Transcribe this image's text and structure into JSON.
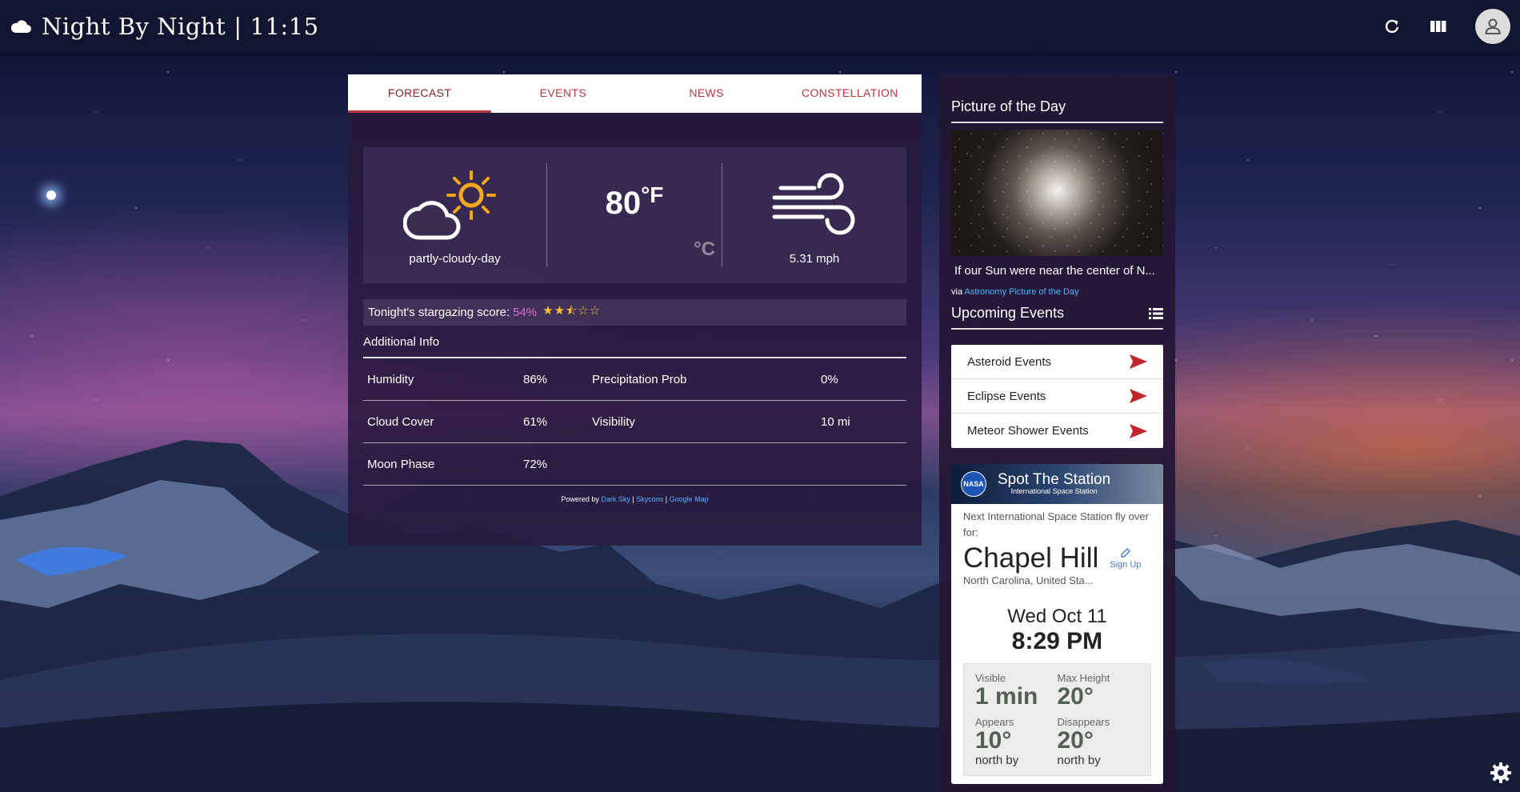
{
  "header": {
    "title": "Night By Night",
    "separator": "|",
    "time": "11:15"
  },
  "tabs": [
    {
      "label": "FORECAST",
      "active": true
    },
    {
      "label": "EVENTS",
      "active": false
    },
    {
      "label": "NEWS",
      "active": false
    },
    {
      "label": "CONSTELLATION",
      "active": false
    }
  ],
  "forecast": {
    "icon_label": "partly-cloudy-day",
    "temperature": "80",
    "unit_primary": "°F",
    "unit_alt": "°C",
    "wind": "5.31 mph",
    "stargazing_label": "Tonight's stargazing score:",
    "stargazing_score": "54%",
    "stars_text": "★★⯪☆☆",
    "additional_title": "Additional Info",
    "info": [
      {
        "k1": "Humidity",
        "v1": "86%",
        "k2": "Precipitation Prob",
        "v2": "0%"
      },
      {
        "k1": "Cloud Cover",
        "v1": "61%",
        "k2": "Visibility",
        "v2": "10 mi"
      },
      {
        "k1": "Moon Phase",
        "v1": "72%",
        "k2": "",
        "v2": ""
      }
    ],
    "powered_label": "Powered by",
    "powered_links": [
      "Dark Sky",
      "Skycons",
      "Google Map"
    ]
  },
  "side": {
    "apod_title": "Picture of the Day",
    "apod_caption": "If our Sun were near the center of N...",
    "via_label": "via",
    "via_link": "Astronomy Picture of the Day",
    "events_title": "Upcoming Events",
    "events": [
      "Asteroid Events",
      "Eclipse Events",
      "Meteor Shower Events"
    ]
  },
  "station": {
    "banner_title": "Spot The Station",
    "banner_subtitle": "International Space Station",
    "nasa": "NASA",
    "next_text": "Next International Space Station fly over for:",
    "city": "Chapel Hill",
    "signup": "Sign Up",
    "region": "North Carolina, United Sta...",
    "date": "Wed Oct 11",
    "time": "8:29 PM",
    "visible_label": "Visible",
    "visible": "1 min",
    "max_height_label": "Max Height",
    "max_height": "20°",
    "appears_label": "Appears",
    "appears": "10°",
    "appears_dir": "north by",
    "disappears_label": "Disappears",
    "disappears": "20°",
    "disappears_dir": "north by"
  },
  "colors": {
    "accent_red": "#b5383c",
    "score_pink": "#e06ad0",
    "star_yellow": "#f7c232",
    "link_blue": "#4fb3ff"
  }
}
